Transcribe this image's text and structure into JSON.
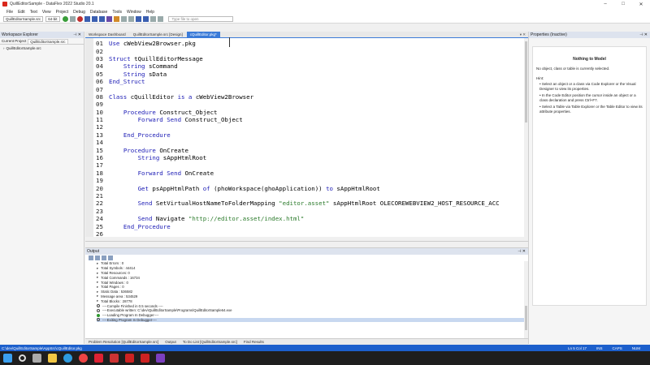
{
  "window": {
    "title": "QuillEditorSample - DataFlex 2022 Studio 20.1",
    "controls": [
      "–",
      "□",
      "✕"
    ]
  },
  "menu": [
    "File",
    "Edit",
    "Text",
    "View",
    "Project",
    "Debug",
    "Database",
    "Tools",
    "Window",
    "Help"
  ],
  "toolbar": {
    "project_combo": "QuillEditorSample.src",
    "bitness_combo": "64-bit",
    "search_placeholder": "Type file to open"
  },
  "workspace_explorer": {
    "title": "Workspace Explorer",
    "tabs": [
      "Current Project",
      "QuillEditorSample.src"
    ],
    "items": [
      "QuillEditorSample.src"
    ]
  },
  "document_tabs": [
    "Workspace Dashboard",
    "QuillEditorSample.src [Design]",
    "cQuillEditor.pkg*"
  ],
  "editor": {
    "lines": [
      {
        "n": "01",
        "text": "Use cWebView2Browser.pkg"
      },
      {
        "n": "02",
        "text": ""
      },
      {
        "n": "03",
        "text": "Struct tQuillEditorMessage"
      },
      {
        "n": "04",
        "text": "    String sCommand"
      },
      {
        "n": "05",
        "text": "    String sData"
      },
      {
        "n": "06",
        "text": "End_Struct"
      },
      {
        "n": "07",
        "text": ""
      },
      {
        "n": "08",
        "text": "Class cQuillEditor is a cWebView2Browser"
      },
      {
        "n": "09",
        "text": ""
      },
      {
        "n": "10",
        "text": "    Procedure Construct_Object"
      },
      {
        "n": "11",
        "text": "        Forward Send Construct_Object"
      },
      {
        "n": "12",
        "text": ""
      },
      {
        "n": "13",
        "text": "    End_Procedure"
      },
      {
        "n": "14",
        "text": ""
      },
      {
        "n": "15",
        "text": "    Procedure OnCreate"
      },
      {
        "n": "16",
        "text": "        String sAppHtmlRoot"
      },
      {
        "n": "17",
        "text": ""
      },
      {
        "n": "18",
        "text": "        Forward Send OnCreate"
      },
      {
        "n": "19",
        "text": ""
      },
      {
        "n": "20",
        "text": "        Get psAppHtmlPath of (phoWorkspace(ghoApplication)) to sAppHtmlRoot"
      },
      {
        "n": "21",
        "text": ""
      },
      {
        "n": "22",
        "text": "        Send SetVirtualHostNameToFolderMapping \"editor.asset\" sAppHtmlRoot OLECOREWEBVIEW2_HOST_RESOURCE_ACC"
      },
      {
        "n": "23",
        "text": ""
      },
      {
        "n": "24",
        "text": "        Send Navigate \"http://editor.asset/index.html\""
      },
      {
        "n": "25",
        "text": "    End_Procedure"
      },
      {
        "n": "26",
        "text": ""
      }
    ]
  },
  "properties": {
    "title": "Properties (Inactive)",
    "heading": "Nothing to Model",
    "info": "No object, class or table is currently selected.",
    "hint_label": "Hint:",
    "hints": [
      "Select an object or a class via Code Explorer or the Visual Designer to view its properties.",
      "In the Code Editor position the cursor inside an object or a class declaration and press Ctrl+F7.",
      "Select a Table via Table Explorer or the Table Editor to view its attribute properties."
    ]
  },
  "output": {
    "title": "Output",
    "lines": [
      {
        "kind": "arrow",
        "text": "Total Errors   : 0"
      },
      {
        "kind": "arrow",
        "text": "Total Symbols : 44414"
      },
      {
        "kind": "arrow",
        "text": "Total Resources: 0"
      },
      {
        "kind": "arrow",
        "text": "Total Commands : 16734"
      },
      {
        "kind": "arrow",
        "text": "Total Windows  : 0"
      },
      {
        "kind": "arrow",
        "text": "Total Pages    : 0"
      },
      {
        "kind": "arrow",
        "text": "Static Data    : 536582"
      },
      {
        "kind": "arrow",
        "text": "Message area   : 534529"
      },
      {
        "kind": "arrow",
        "text": "Total Blocks   : 28778"
      },
      {
        "kind": "circ",
        "text": "----Compile Finished in 0.5 seconds ----"
      },
      {
        "kind": "circ",
        "text": "----Executable written: C:\\dev\\QuillEditorSample\\Programs\\QuillEditorSample64.exe"
      },
      {
        "kind": "green",
        "text": "----Loading Program In Debugger----"
      },
      {
        "kind": "circ-sel",
        "text": "----Exiting Program In Debugger----"
      }
    ]
  },
  "bottom_tabs": [
    "Problem Resolution [QuillEditorSample.src]",
    "Output",
    "To Do List [QuillEditorSample.src]",
    "Find Results"
  ],
  "status": {
    "path": "C:\\dev\\QuillEditorSample\\AppSrc\\cQuillEditor.pkg",
    "position": "Ln 5      Col 17",
    "ins": "INS",
    "caps": "CAPS",
    "num": "NUM"
  }
}
